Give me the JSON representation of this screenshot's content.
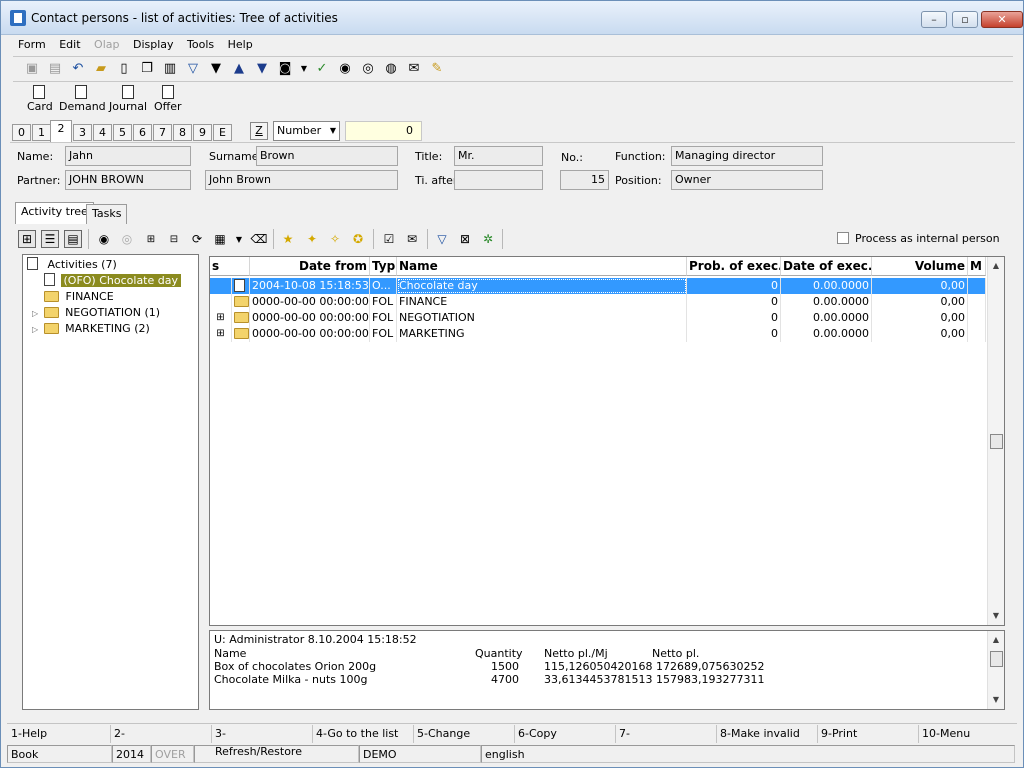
{
  "window": {
    "title": "Contact persons - list of activities: Tree of activities",
    "min_label": "–",
    "max_label": "▫",
    "close_label": "✕"
  },
  "menu": [
    "Form",
    "Edit",
    "Olap",
    "Display",
    "Tools",
    "Help"
  ],
  "toolbar2": [
    "Card",
    "Demand",
    "Journal",
    "Offer"
  ],
  "number_tabs": [
    "0",
    "1",
    "2",
    "3",
    "4",
    "5",
    "6",
    "7",
    "8",
    "9",
    "E"
  ],
  "filter": {
    "z_label": "Z",
    "combo": "Number",
    "value": "0"
  },
  "contact": {
    "name_label": "Name:",
    "name": "Jahn",
    "surname_label": "Surname:",
    "surname": "Brown",
    "title_label": "Title:",
    "title": "Mr.",
    "no_label": "No.:",
    "no": "15",
    "function_label": "Function:",
    "function": "Managing director",
    "partner_label": "Partner:",
    "partner": "JOHN BROWN",
    "partner_person": "John Brown",
    "ti_after_label": "Ti. after",
    "ti_after": "",
    "position_label": "Position:",
    "position": "Owner"
  },
  "page_tabs": [
    "Activity tree",
    "Tasks"
  ],
  "process_internal": "Process as internal person",
  "tree": {
    "root": "Activities (7)",
    "items": [
      "(OFO) Chocolate day",
      "FINANCE",
      "NEGOTIATION (1)",
      "MARKETING (2)"
    ]
  },
  "grid": {
    "headers": {
      "s": "s",
      "date_from": "Date from",
      "type": "Typ",
      "name": "Name",
      "prob": "Prob. of exec.",
      "date_exec": "Date of exec.",
      "volume": "Volume",
      "m": "M"
    },
    "rows": [
      {
        "date_from": "2004-10-08 15:18:53",
        "type": "O...",
        "name": "Chocolate day",
        "prob": "0",
        "date_exec": "0.00.0000",
        "volume": "0,00"
      },
      {
        "date_from": "0000-00-00 00:00:00",
        "type": "FOL",
        "name": "FINANCE",
        "prob": "0",
        "date_exec": "0.00.0000",
        "volume": "0,00"
      },
      {
        "date_from": "0000-00-00 00:00:00",
        "type": "FOL",
        "name": "NEGOTIATION",
        "prob": "0",
        "date_exec": "0.00.0000",
        "volume": "0,00"
      },
      {
        "date_from": "0000-00-00 00:00:00",
        "type": "FOL",
        "name": "MARKETING",
        "prob": "0",
        "date_exec": "0.00.0000",
        "volume": "0,00"
      }
    ]
  },
  "detail": {
    "user_line": "U: Administrator 8.10.2004 15:18:52",
    "headers": {
      "name": "Name",
      "quantity": "Quantity",
      "netto_mj": "Netto pl./Mj",
      "netto": "Netto pl."
    },
    "rows": [
      {
        "name": "Box of chocolates Orion 200g",
        "quantity": "1500",
        "netto_mj": "115,126050420168",
        "netto": "172689,075630252"
      },
      {
        "name": "Chocolate Milka - nuts 100g",
        "quantity": "4700",
        "netto_mj": "33,6134453781513",
        "netto": "157983,193277311"
      }
    ]
  },
  "fkeys": [
    "1-Help",
    "2-",
    "3-Refresh/Restore",
    "4-Go to the list",
    "5-Change",
    "6-Copy",
    "7-",
    "8-Make invalid",
    "9-Print",
    "10-Menu"
  ],
  "status": [
    "Book",
    "2014",
    "OVER",
    "",
    "DEMO",
    "english"
  ],
  "colors": {
    "selection": "#3399ff",
    "tree_selection": "#8b8b1f",
    "number_field": "#ffffe0"
  }
}
